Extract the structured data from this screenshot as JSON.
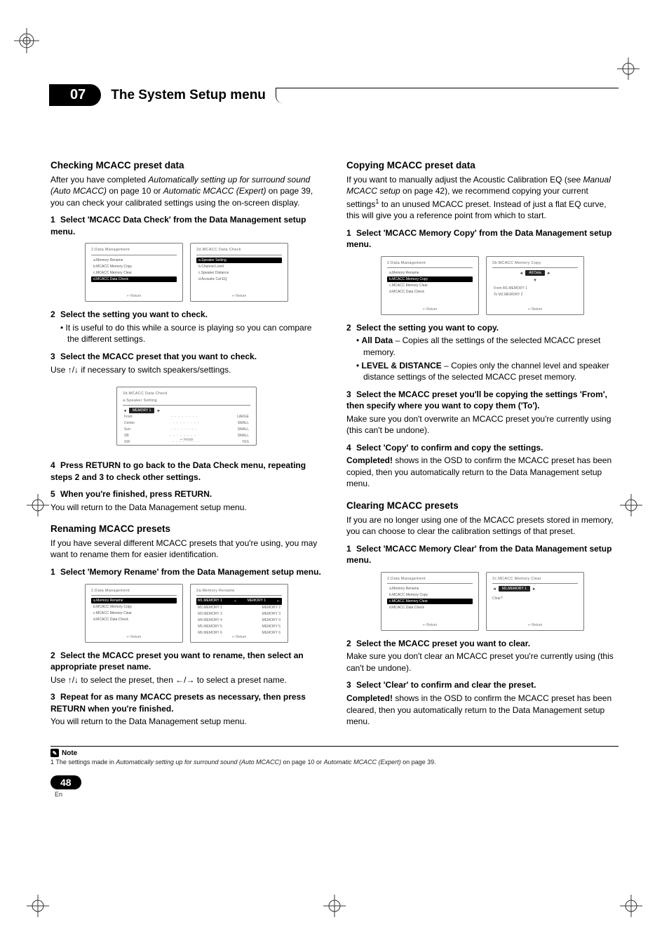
{
  "header": {
    "chapter_number": "07",
    "chapter_title": "The System Setup menu"
  },
  "left": {
    "sec1": {
      "title": "Checking MCACC preset data",
      "intro_a": "After you have completed ",
      "intro_i1": "Automatically setting up for surround sound (Auto MCACC)",
      "intro_b": " on page 10 or ",
      "intro_i2": "Automatic MCACC (Expert)",
      "intro_c": " on page 39, you can check your calibrated settings using the on-screen display.",
      "step1": "Select 'MCACC Data Check' from the Data Management setup menu.",
      "osd1_title": "2.Data Management",
      "osd1_items": [
        "a.Memory Rename",
        "b.MCACC Memory Copy",
        "c.MCACC Memory Clear",
        "d.MCACC Data Check"
      ],
      "osd1_foot": "↩ Return",
      "osd2_title": "2d.MCACC Data Check",
      "osd2_items": [
        "a.Speaker Setting",
        "b.Channel Level",
        "c.Speaker Distance",
        "d.Acoustic Cal EQ"
      ],
      "osd2_foot": "↩ Return",
      "step2": "Select the setting you want to check.",
      "step2_bullet": "It is useful to do this while a source is playing so you can compare the different settings.",
      "step3": "Select the MCACC preset that you want to check.",
      "step3_body_a": "Use ",
      "step3_body_b": " if necessary to switch speakers/settings.",
      "osd3_title": "2d.MCACC Data Check",
      "osd3_sub": "a.Speaker Setting",
      "osd3_mem": "MEMORY 1",
      "osd3_rows": [
        [
          "Front",
          "LARGE"
        ],
        [
          "Center",
          "SMALL"
        ],
        [
          "Surr",
          "SMALL"
        ],
        [
          "SB",
          "SMALL"
        ],
        [
          "SW",
          "YES"
        ]
      ],
      "osd3_foot": "↩ Finish",
      "step4": "Press RETURN to go back to the Data Check menu, repeating steps 2 and 3 to check other settings.",
      "step5": "When you're finished, press RETURN.",
      "step5_body": "You will return to the Data Management setup menu."
    },
    "sec2": {
      "title": "Renaming MCACC presets",
      "intro": "If you have several different MCACC presets that you're using, you may want to rename them for easier identification.",
      "step1": "Select 'Memory Rename' from the Data Management setup menu.",
      "osd1_title": "2.Data Management",
      "osd1_items": [
        "a.Memory Rename",
        "b.MCACC Memory Copy",
        "c.MCACC Memory Clear",
        "d.MCACC Data Check"
      ],
      "osd2_title": "2a.Memory Rename",
      "osd2_rows": [
        [
          "M1.MEMORY 1",
          "MEMORY 1"
        ],
        [
          "M2.MEMORY 2",
          "MEMORY 2"
        ],
        [
          "M3.MEMORY 3",
          "MEMORY 3"
        ],
        [
          "M4.MEMORY 4",
          "MEMORY 4"
        ],
        [
          "M5.MEMORY 5",
          "MEMORY 5"
        ],
        [
          "M6.MEMORY 6",
          "MEMORY 6"
        ]
      ],
      "osd_foot": "↩ Return",
      "step2": "Select the MCACC preset you want to rename, then select an appropriate preset name.",
      "step2_body_a": "Use ",
      "step2_body_b": " to select the preset, then ",
      "step2_body_c": " to select a preset name.",
      "step3": "Repeat for as many MCACC presets as necessary, then press RETURN when you're finished.",
      "step3_body": "You will return to the Data Management setup menu."
    }
  },
  "right": {
    "sec1": {
      "title": "Copying MCACC preset data",
      "intro_a": "If you want to manually adjust the Acoustic Calibration EQ (see ",
      "intro_i1": "Manual MCACC setup",
      "intro_b": " on page 42), we recommend copying your current settings",
      "intro_sup": "1",
      "intro_c": " to an unused MCACC preset. Instead of just a flat EQ curve, this will give you a reference point from which to start.",
      "step1": "Select 'MCACC Memory Copy' from the Data Management setup menu.",
      "osd1_title": "2.Data Management",
      "osd1_items": [
        "a.Memory Rename",
        "b.MCACC Memory Copy",
        "c.MCACC Memory Clear",
        "d.MCACC Data Check"
      ],
      "osd2_title": "2b.MCACC Memory Copy",
      "osd2_item": "All Data",
      "osd2_from": "From  M1.MEMORY 1",
      "osd2_to": "To    M2.MEMORY 2",
      "osd_foot": "↩ Return",
      "step2": "Select the setting you want to copy.",
      "bullets": [
        {
          "lead": "All Data",
          "rest": " – Copies all the settings of the selected MCACC preset memory."
        },
        {
          "lead": "LEVEL & DISTANCE",
          "rest": " – Copies only the channel level and speaker distance settings of the selected MCACC preset memory."
        }
      ],
      "step3": "Select the MCACC preset you'll be copying the settings 'From', then specify where you want to copy them ('To').",
      "step3_body": "Make sure you don't overwrite an MCACC preset you're currently using (this can't be undone).",
      "step4": "Select 'Copy' to confirm and copy the settings.",
      "step4_body_a": "Completed!",
      "step4_body_b": " shows in the OSD to confirm the MCACC preset has been copied, then you automatically return to the Data Management setup menu."
    },
    "sec2": {
      "title": "Clearing MCACC presets",
      "intro": "If you are no longer using one of the MCACC presets stored in memory, you can choose to clear the calibration settings of that preset.",
      "step1": "Select 'MCACC Memory Clear' from the Data Management setup menu.",
      "osd1_title": "2.Data Management",
      "osd1_items": [
        "a.Memory Rename",
        "b.MCACC Memory Copy",
        "c.MCACC Memory Clear",
        "d.MCACC Data Check"
      ],
      "osd2_title": "2c.MCACC Memory Clear",
      "osd2_row": "M1.MEMORY 1",
      "osd2_clear": "Clear?",
      "osd_foot": "↩ Return",
      "step2": "Select the MCACC preset you want to clear.",
      "step2_body": "Make sure you don't clear an MCACC preset you're currently using (this can't be undone).",
      "step3": "Select 'Clear' to confirm and clear the preset.",
      "step3_body_a": "Completed!",
      "step3_body_b": " shows in the OSD to confirm the MCACC preset has been cleared, then you automatically return to the Data Management setup menu."
    }
  },
  "footnote": {
    "label": "Note",
    "text_a": "1 The settings made in ",
    "text_i1": "Automatically setting up for surround sound (Auto MCACC)",
    "text_b": " on page 10 or ",
    "text_i2": "Automatic MCACC (Expert)",
    "text_c": " on page 39."
  },
  "footer": {
    "page": "48",
    "lang": "En"
  },
  "glyphs": {
    "up": "↑",
    "down": "↓",
    "left": "←",
    "right": "→",
    "updown": "↑/↓",
    "leftright": "←/→"
  }
}
